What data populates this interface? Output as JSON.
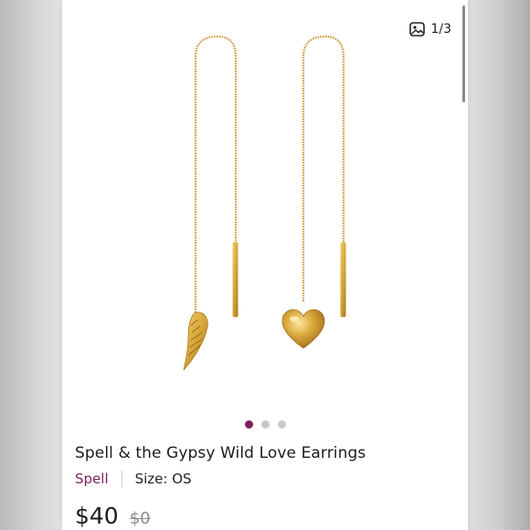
{
  "gallery": {
    "counter": "1/3",
    "counter_icon": "image-gallery-icon",
    "dots": 3,
    "active_dot": 0
  },
  "product": {
    "title": "Spell & the Gypsy Wild Love Earrings",
    "brand": "Spell",
    "size": "Size: OS",
    "price": "$40",
    "original_price": "$0"
  },
  "colors": {
    "brand_accent": "#7a1f5c",
    "gold": "#d6a53a"
  }
}
